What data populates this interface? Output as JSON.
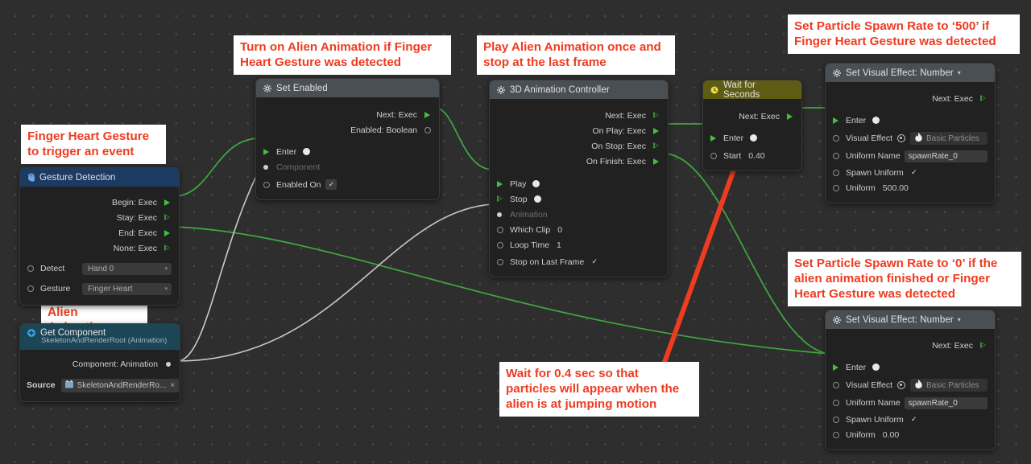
{
  "canvas": {
    "background": "#2e2e2e",
    "grid_dot_color": "#4a4a4a",
    "wire_exec_color": "#3fa93f",
    "wire_data_color": "#c8c8c8",
    "arrow_color": "#ef3b20"
  },
  "notes": [
    {
      "id": "note-gesture",
      "text": "Finger Heart Gesture\nto trigger an event"
    },
    {
      "id": "note-alien-animation",
      "text": "Alien Animation"
    },
    {
      "id": "note-set-enabled",
      "text": "Turn on Alien Animation if Finger\nHeart Gesture was detected"
    },
    {
      "id": "note-anim-controller",
      "text": "Play Alien Animation once and\nstop at the last frame"
    },
    {
      "id": "note-spawn-500",
      "text": "Set Particle Spawn Rate to ‘500’ if\nFinger Heart Gesture was detected"
    },
    {
      "id": "note-spawn-0",
      "text": "Set Particle Spawn Rate to ‘0’ if the\nalien animation finished or Finger\nHeart Gesture was detected"
    },
    {
      "id": "note-wait",
      "text": "Wait for 0.4 sec so that\nparticles will appear when the\nalien is at jumping motion"
    }
  ],
  "nodes": {
    "gesture_detection": {
      "title": "Gesture Detection",
      "icon": "hand-icon",
      "outputs": [
        {
          "label": "Begin: Exec",
          "pin": "tri-filled"
        },
        {
          "label": "Stay: Exec",
          "pin": "tri-hollow"
        },
        {
          "label": "End: Exec",
          "pin": "tri-filled"
        },
        {
          "label": "None: Exec",
          "pin": "tri-hollow"
        }
      ],
      "fields": [
        {
          "label": "Detect",
          "value": "Hand 0",
          "control": "select"
        },
        {
          "label": "Gesture",
          "value": "Finger Heart",
          "control": "select"
        }
      ]
    },
    "get_component": {
      "title": "Get Component",
      "subtitle": "SkeletonAndRenderRoot (Animation)",
      "icon": "plus-circle-icon",
      "outputs": [
        {
          "label": "Component: Animation",
          "pin": "dot-small"
        }
      ],
      "source_label": "Source",
      "source_value": "SkeletonAndRenderRo...",
      "source_icon": "object-icon",
      "source_clear": "×"
    },
    "set_enabled": {
      "title": "Set Enabled",
      "icon": "gear-icon",
      "outputs": [
        {
          "label": "Next: Exec",
          "pin": "tri-filled"
        },
        {
          "label": "Enabled: Boolean",
          "pin": "dot-hollow"
        }
      ],
      "inputs": [
        {
          "label": "Enter",
          "pin": "tri-filled",
          "knob": "dot-filled"
        },
        {
          "label": "Component",
          "pin": "dot-small",
          "dim": true
        },
        {
          "label": "Enabled On",
          "pin": "dot-hollow",
          "check": "✓"
        }
      ]
    },
    "anim_controller": {
      "title": "3D Animation Controller",
      "icon": "gear-icon",
      "outputs": [
        {
          "label": "Next: Exec",
          "pin": "tri-hollow"
        },
        {
          "label": "On Play: Exec",
          "pin": "tri-filled"
        },
        {
          "label": "On Stop: Exec",
          "pin": "tri-hollow"
        },
        {
          "label": "On Finish: Exec",
          "pin": "tri-filled"
        }
      ],
      "inputs": [
        {
          "label": "Play",
          "pin": "tri-filled",
          "knob": "dot-filled"
        },
        {
          "label": "Stop",
          "pin": "tri-hollow",
          "knob": "dot-filled"
        },
        {
          "label": "Animation",
          "pin": "dot-small",
          "dim": true
        },
        {
          "label": "Which Clip",
          "pin": "dot-hollow",
          "value": "0"
        },
        {
          "label": "Loop Time",
          "pin": "dot-hollow",
          "value": "1"
        },
        {
          "label": "Stop on Last Frame",
          "pin": "dot-hollow",
          "check": "✓"
        }
      ]
    },
    "wait_for_seconds": {
      "title": "Wait for Seconds",
      "icon": "clock-icon",
      "outputs": [
        {
          "label": "Next: Exec",
          "pin": "tri-filled"
        }
      ],
      "inputs": [
        {
          "label": "Enter",
          "pin": "tri-filled",
          "knob": "dot-filled"
        },
        {
          "label": "Start",
          "pin": "dot-hollow",
          "value": "0.40"
        }
      ]
    },
    "set_vfx_500": {
      "title": "Set Visual Effect: Number",
      "title_caret": "▾",
      "icon": "gear-icon",
      "outputs": [
        {
          "label": "Next: Exec",
          "pin": "tri-hollow"
        }
      ],
      "inputs": [
        {
          "label": "Enter",
          "pin": "tri-filled",
          "knob": "dot-filled"
        },
        {
          "label": "Visual Effect",
          "pin": "dot-hollow",
          "asset": "Basic Particles",
          "asset_icon": "flame-icon"
        },
        {
          "label": "Uniform Name",
          "pin": "dot-hollow",
          "text": "spawnRate_0"
        },
        {
          "label": "Spawn Uniform",
          "pin": "dot-hollow",
          "check": "✓"
        },
        {
          "label": "Uniform",
          "pin": "dot-hollow",
          "value": "500.00"
        }
      ]
    },
    "set_vfx_0": {
      "title": "Set Visual Effect: Number",
      "title_caret": "▾",
      "icon": "gear-icon",
      "outputs": [
        {
          "label": "Next: Exec",
          "pin": "tri-hollow"
        }
      ],
      "inputs": [
        {
          "label": "Enter",
          "pin": "tri-filled",
          "knob": "dot-filled"
        },
        {
          "label": "Visual Effect",
          "pin": "dot-hollow",
          "asset": "Basic Particles",
          "asset_icon": "flame-icon"
        },
        {
          "label": "Uniform Name",
          "pin": "dot-hollow",
          "text": "spawnRate_0"
        },
        {
          "label": "Spawn Uniform",
          "pin": "dot-hollow",
          "check": "✓"
        },
        {
          "label": "Uniform",
          "pin": "dot-hollow",
          "value": "0.00"
        }
      ]
    }
  }
}
